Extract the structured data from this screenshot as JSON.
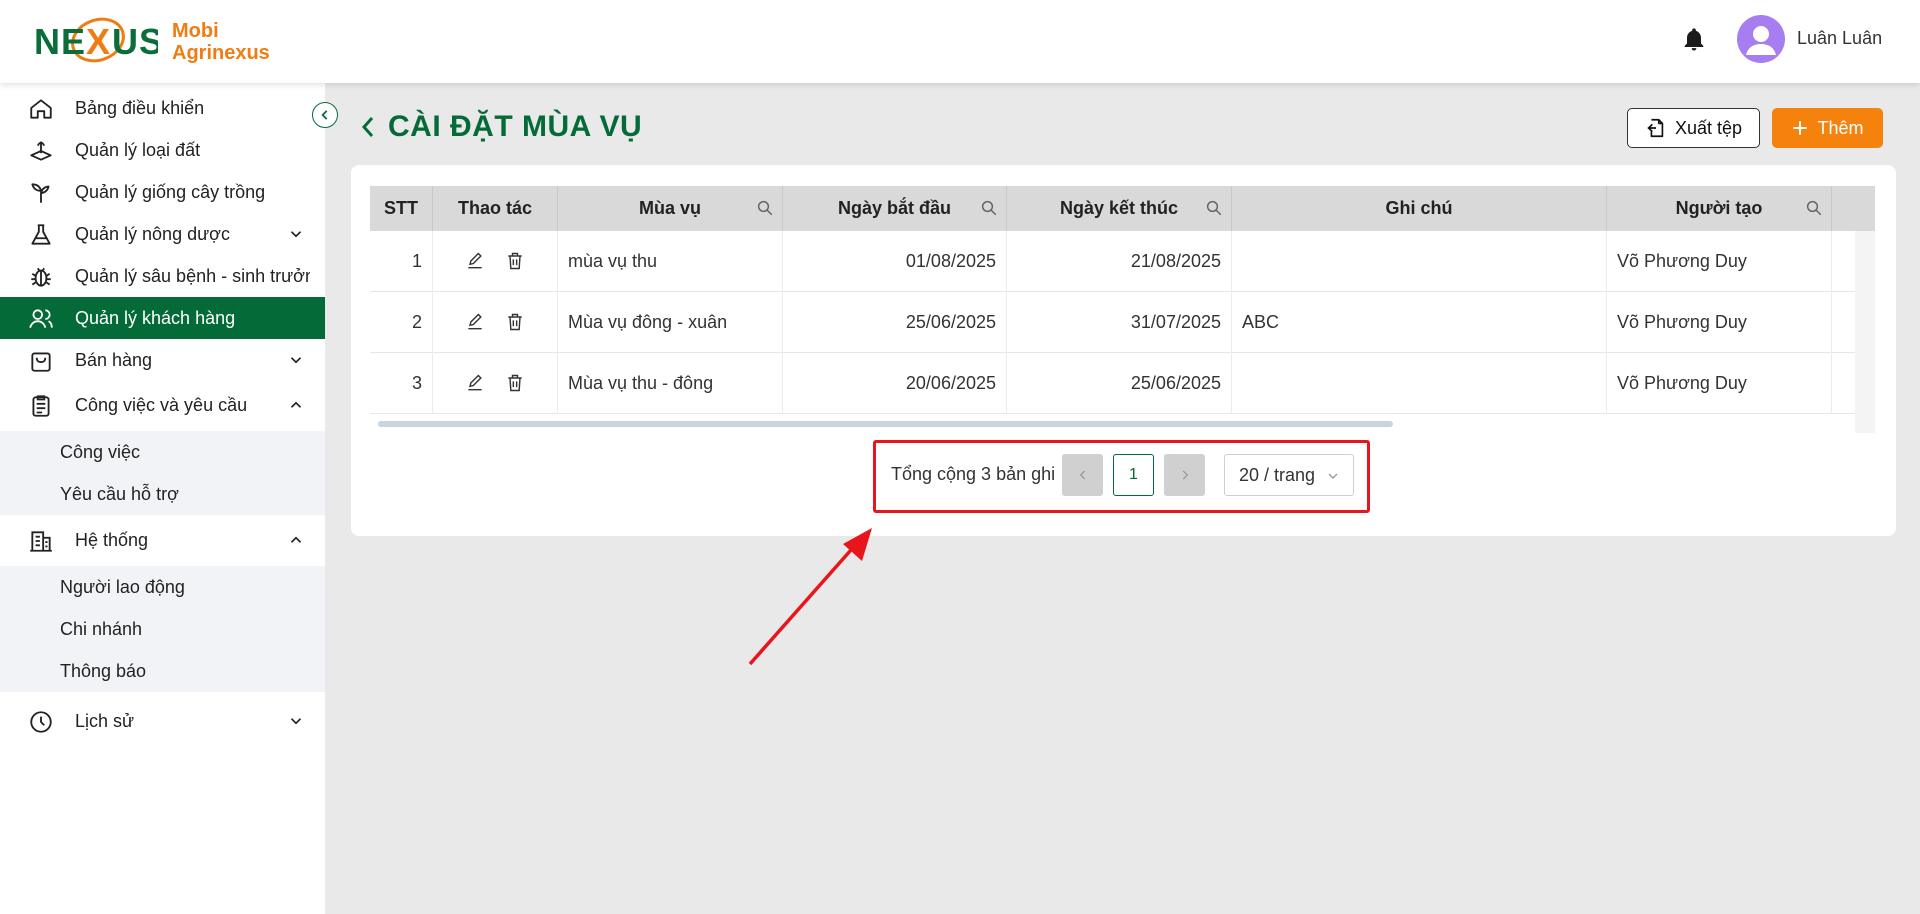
{
  "brand": {
    "logo_text": "NEXUS",
    "name_line1": "Mobi",
    "name_line2": "Agrinexus",
    "logo_green": "#0b6e3a",
    "logo_orange": "#f07c12"
  },
  "header": {
    "user_name": "Luân Luân",
    "bell_icon": "bell-icon",
    "avatar_color": "#a77ef0"
  },
  "sidebar": {
    "items": [
      {
        "label": "Bảng điều khiển",
        "icon": "home-icon"
      },
      {
        "label": "Quản lý loại đất",
        "icon": "soil-icon"
      },
      {
        "label": "Quản lý giống cây trồng",
        "icon": "plant-icon"
      },
      {
        "label": "Quản lý nông dược",
        "icon": "flask-icon"
      },
      {
        "label": "Quản lý sâu bệnh - sinh trưởng",
        "icon": "bug-icon"
      },
      {
        "label": "Quản lý khách hàng",
        "icon": "users-icon"
      },
      {
        "label": "Bán hàng",
        "icon": "bag-icon"
      },
      {
        "label": "Công việc và yêu cầu",
        "icon": "clipboard-icon"
      },
      {
        "label": "Hệ thống",
        "icon": "building-icon"
      },
      {
        "label": "Lịch sử",
        "icon": "history-icon"
      }
    ],
    "sub_work": [
      {
        "label": "Công việc"
      },
      {
        "label": "Yêu cầu hỗ trợ"
      }
    ],
    "sub_system": [
      {
        "label": "Người lao động"
      },
      {
        "label": "Chi nhánh"
      },
      {
        "label": "Thông báo"
      }
    ],
    "active_color": "#046b38"
  },
  "page": {
    "title": "CÀI ĐẶT MÙA VỤ",
    "export_label": "Xuất tệp",
    "add_label": "Thêm",
    "accent": "#f5820d"
  },
  "table": {
    "columns": {
      "stt": "STT",
      "actions": "Thao tác",
      "season": "Mùa vụ",
      "start": "Ngày bắt đầu",
      "end": "Ngày kết thúc",
      "note": "Ghi chú",
      "creator": "Người tạo"
    },
    "rows": [
      {
        "stt": "1",
        "season": "mùa vụ thu",
        "start": "01/08/2025",
        "end": "21/08/2025",
        "note": "",
        "creator": "Võ Phương Duy"
      },
      {
        "stt": "2",
        "season": "Mùa vụ đông - xuân",
        "start": "25/06/2025",
        "end": "31/07/2025",
        "note": "ABC",
        "creator": "Võ Phương Duy"
      },
      {
        "stt": "3",
        "season": "Mùa vụ thu - đông",
        "start": "20/06/2025",
        "end": "25/06/2025",
        "note": "",
        "creator": "Võ Phương Duy"
      }
    ]
  },
  "pagination": {
    "total_text": "Tổng cộng 3 bản ghi",
    "current_page": "1",
    "page_size": "20 / trang"
  }
}
